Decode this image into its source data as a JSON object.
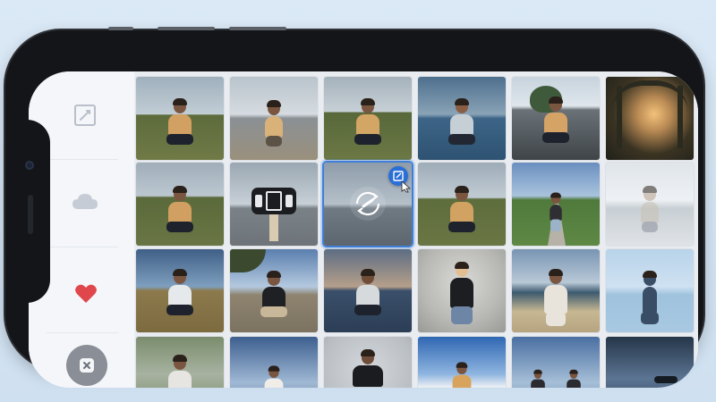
{
  "app": {
    "sidebar": {
      "items": [
        {
          "icon": "edit-icon"
        },
        {
          "icon": "cloud-icon"
        },
        {
          "icon": "heart-icon",
          "color": "#e0474c"
        }
      ],
      "close_icon": "close-icon"
    },
    "selection_badge_icon": "edit-icon",
    "colors": {
      "accent": "#2a6fd6",
      "selection_border": "#3f7fd8",
      "favorite": "#e0474c"
    },
    "grid": {
      "rows": 4,
      "columns": 6,
      "selected": {
        "row": 1,
        "column": 2
      }
    }
  }
}
